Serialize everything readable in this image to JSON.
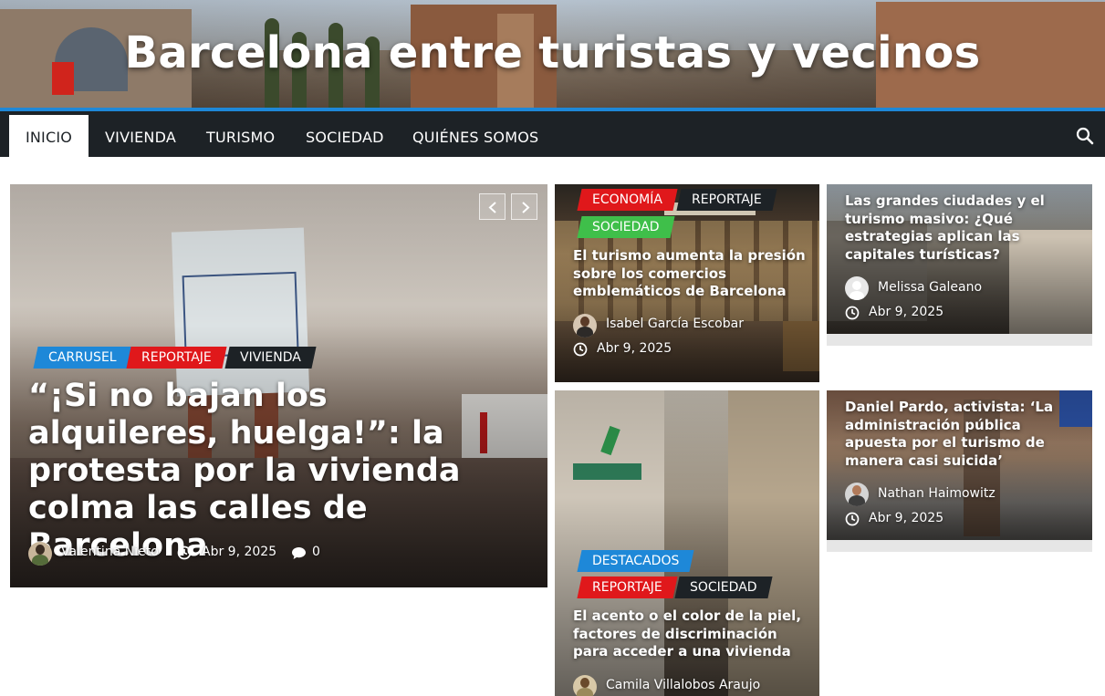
{
  "site": {
    "title": "Barcelona entre turistas y vecinos"
  },
  "nav": {
    "items": [
      {
        "label": "INICIO"
      },
      {
        "label": "VIVIENDA"
      },
      {
        "label": "TURISMO"
      },
      {
        "label": "SOCIEDAD"
      },
      {
        "label": "QUIÉNES SOMOS"
      }
    ],
    "search_icon": "search-icon"
  },
  "colors": {
    "nav_bg": "#1d2226",
    "accent_blue": "#1e88d8",
    "tag_red": "#e0181b",
    "tag_green": "#3fbf4a"
  },
  "hero": {
    "tags": [
      "CARRUSEL",
      "REPORTAJE",
      "VIVIENDA"
    ],
    "title": "“¡Si no bajan los alquileres, huelga!”: la protesta por la vivienda colma las calles de Barcelona",
    "author": "Valentina Nieto",
    "date": "Abr 9, 2025",
    "comments": "0"
  },
  "articles": [
    {
      "tags": [
        "ECONOMÍA",
        "REPORTAJE",
        "SOCIEDAD"
      ],
      "title": "El turismo aumenta la presión sobre los comercios emblemáticos de Barcelona",
      "author": "Isabel García Escobar",
      "date": "Abr 9, 2025"
    },
    {
      "tags": [],
      "title": "Las grandes ciudades y el turismo masivo: ¿Qué estrategias aplican las capitales turísticas?",
      "author": "Melissa Galeano",
      "date": "Abr 9, 2025"
    },
    {
      "tags": [
        "DESTACADOS",
        "REPORTAJE",
        "SOCIEDAD"
      ],
      "title": "El acento o el color de la piel, factores de discriminación para acceder a una vivienda",
      "author": "Camila Villalobos Araujo",
      "date": ""
    },
    {
      "tags": [],
      "title": "Daniel Pardo, activista: ‘La administración pública apuesta por el turismo de manera casi suicida’",
      "author": "Nathan Haimowitz",
      "date": "Abr 9, 2025"
    }
  ]
}
